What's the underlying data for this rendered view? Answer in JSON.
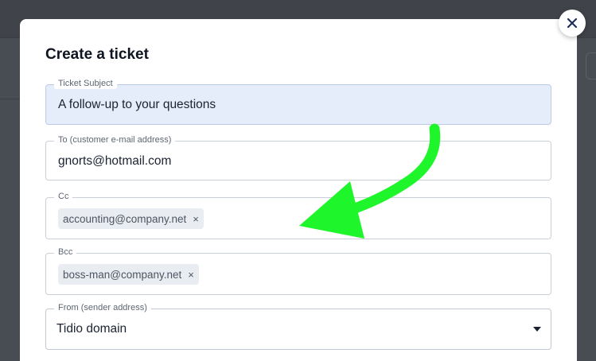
{
  "modal": {
    "title": "Create a ticket",
    "close_icon": "close-icon"
  },
  "fields": {
    "subject": {
      "label": "Ticket Subject",
      "value": "A follow-up to your questions"
    },
    "to": {
      "label": "To (customer e-mail address)",
      "value": "gnorts@hotmail.com"
    },
    "cc": {
      "label": "Cc",
      "chips": [
        {
          "text": "accounting@company.net",
          "remove": "×"
        }
      ]
    },
    "bcc": {
      "label": "Bcc",
      "chips": [
        {
          "text": "boss-man@company.net",
          "remove": "×"
        }
      ]
    },
    "from": {
      "label": "From (sender address)",
      "value": "Tidio domain",
      "caret_icon": "caret-down-icon"
    }
  },
  "annotation": {
    "icon": "arrow-icon",
    "color": "#1ff52b"
  },
  "colors": {
    "overlay": "#484c53",
    "subject_bg": "#e5edfb",
    "chip_bg": "#e9edf2"
  }
}
